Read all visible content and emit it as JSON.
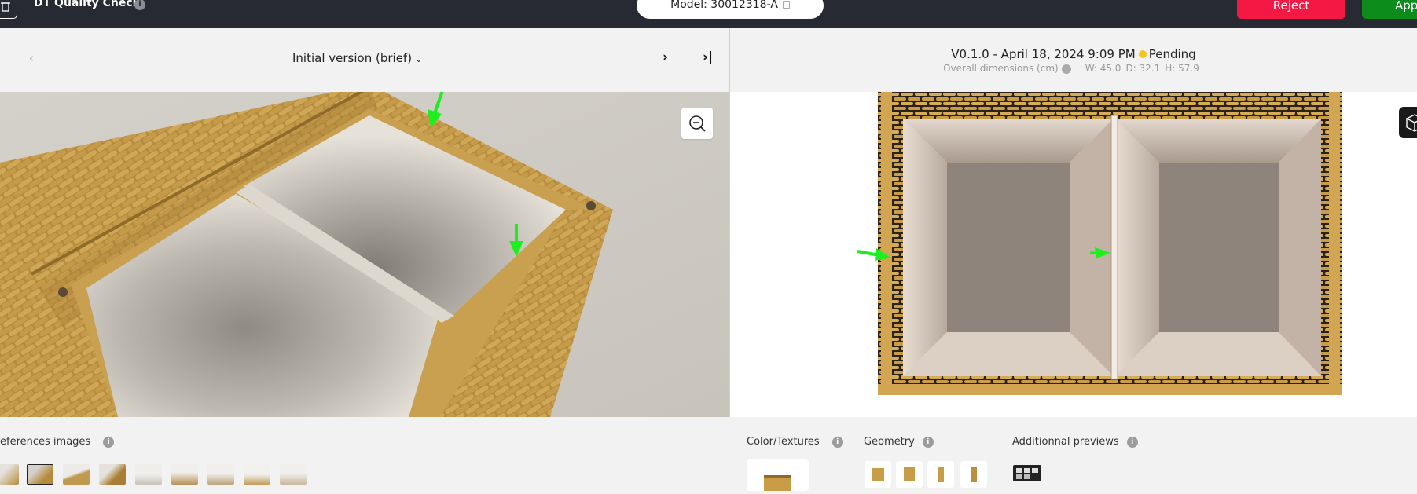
{
  "app": {
    "title": "DT Quality Check",
    "info_icon": "i",
    "home_icon": "trash-icon"
  },
  "model": {
    "label": "Model: 30012318-A"
  },
  "actions": {
    "reject": "Reject",
    "approve": "App"
  },
  "left_panel": {
    "version_label": "Initial version (brief)",
    "prev_icon": "chevron-left-icon",
    "next_icon": "chevron-right-icon",
    "last_icon": "skip-to-last-icon"
  },
  "right_panel": {
    "version": "V0.1.0 - April 18, 2024 9:09 PM",
    "status": "Pending",
    "status_color": "#f5c518",
    "dimensions_label": "Overall dimensions (cm)",
    "width": "W: 45.0",
    "depth": "D: 32.1",
    "height": "H: 57.9"
  },
  "bottom": {
    "references_label": "eferences images",
    "color_textures_label": "Color/Textures",
    "geometry_label": "Geometry",
    "additional_previews_label": "Additionnal previews",
    "info_glyph": "i"
  },
  "colors": {
    "topbar": "#272a33",
    "reject": "#f41845",
    "approve": "#0c8c1a",
    "annotation_arrow": "#1cf01c"
  }
}
